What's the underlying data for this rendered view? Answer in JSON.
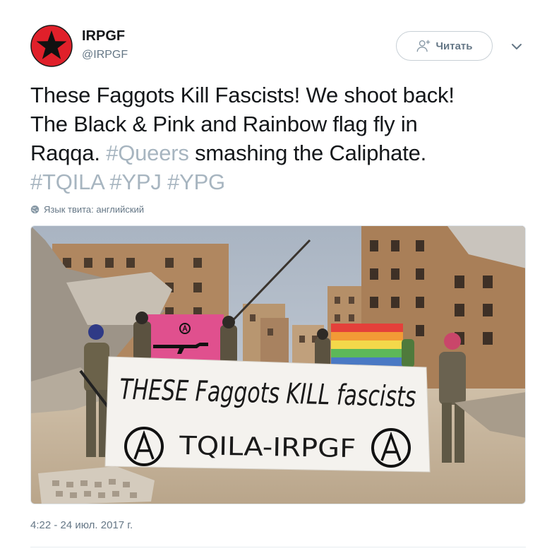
{
  "author": {
    "display_name": "IRPGF",
    "handle": "@IRPGF",
    "avatar_icon": "red-star-avatar-icon"
  },
  "follow_button": {
    "label": "Читать",
    "icon": "add-user-icon"
  },
  "more_menu": {
    "icon": "chevron-down-icon"
  },
  "tweet": {
    "line1": "These Faggots Kill Fascists! We shoot back!",
    "line2": "The Black & Pink and Rainbow flag fly in",
    "line3_prefix": "Raqqa. ",
    "hashtag_queers": "#Queers",
    "line3_suffix": " smashing the Caliphate.",
    "hashtags": [
      "#TQILA",
      "#YPJ",
      "#YPG"
    ]
  },
  "language_note": "Язык твита: английский",
  "photo": {
    "description": "",
    "banner_line1": "THESE Faggots KILL fascists",
    "banner_line2": "TQILA-IRPGF"
  },
  "timestamp": "4:22 - 24 июл. 2017 г.",
  "colors": {
    "text": "#14171a",
    "secondary": "#657786",
    "hashtag": "#a7b5c0",
    "avatar_red": "#e0202a",
    "border": "#c8d0d6"
  }
}
